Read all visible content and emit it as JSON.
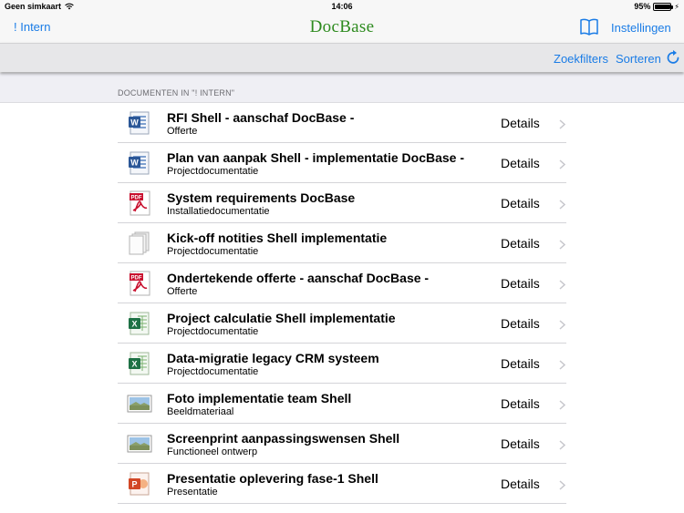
{
  "status": {
    "carrier": "Geen simkaart",
    "time": "14:06",
    "battery": "95%",
    "battery_level": 0.95
  },
  "nav": {
    "back_label": "! Intern",
    "title": "DocBase",
    "settings_label": "Instellingen"
  },
  "toolbar": {
    "filter_label": "Zoekfilters",
    "sort_label": "Sorteren"
  },
  "section": {
    "title": "DOCUMENTEN IN \"! INTERN\""
  },
  "colors": {
    "accent": "#1a7ce6",
    "title_green": "#2e8b1f"
  },
  "documents": [
    {
      "title": "RFI Shell - aanschaf DocBase -",
      "subtitle": "Offerte",
      "type": "word",
      "action": "Details"
    },
    {
      "title": "Plan van aanpak Shell - implementatie DocBase -",
      "subtitle": "Projectdocumentatie",
      "type": "word",
      "action": "Details"
    },
    {
      "title": "System requirements DocBase",
      "subtitle": "Installatiedocumentatie",
      "type": "pdf",
      "action": "Details"
    },
    {
      "title": "Kick-off notities Shell implementatie",
      "subtitle": "Projectdocumentatie",
      "type": "generic",
      "action": "Details"
    },
    {
      "title": "Ondertekende offerte - aanschaf DocBase -",
      "subtitle": "Offerte",
      "type": "pdf",
      "action": "Details"
    },
    {
      "title": "Project calculatie Shell implementatie",
      "subtitle": "Projectdocumentatie",
      "type": "excel",
      "action": "Details"
    },
    {
      "title": "Data-migratie legacy CRM systeem",
      "subtitle": "Projectdocumentatie",
      "type": "excel",
      "action": "Details"
    },
    {
      "title": "Foto implementatie team Shell",
      "subtitle": "Beeldmateriaal",
      "type": "image",
      "action": "Details"
    },
    {
      "title": "Screenprint aanpassingswensen Shell",
      "subtitle": "Functioneel ontwerp",
      "type": "image",
      "action": "Details"
    },
    {
      "title": "Presentatie oplevering fase-1 Shell",
      "subtitle": "Presentatie",
      "type": "powerpoint",
      "action": "Details"
    }
  ]
}
